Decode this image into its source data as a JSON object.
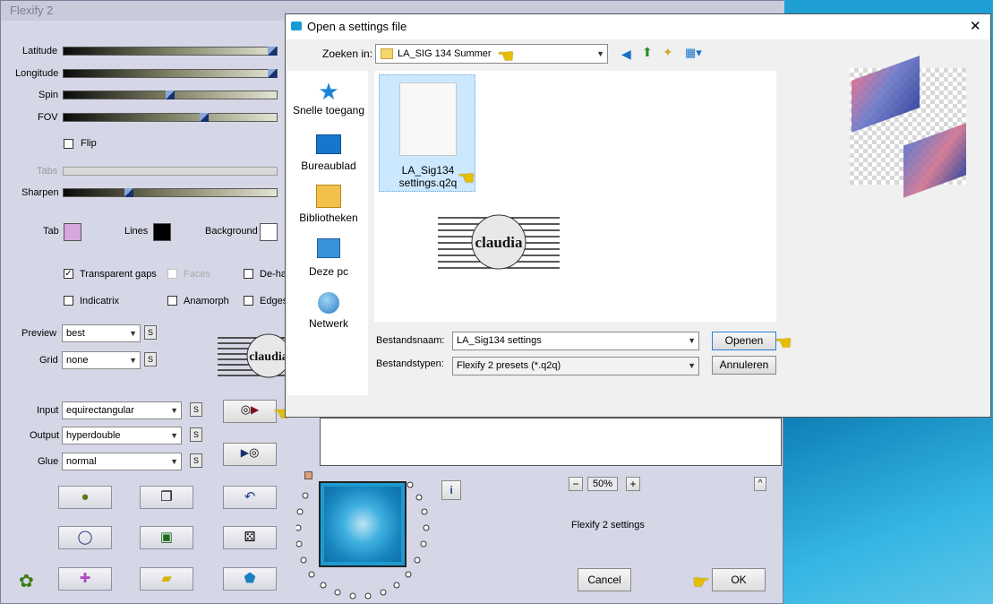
{
  "flexify": {
    "title": "Flexify 2",
    "latitude_label": "Latitude",
    "longitude_label": "Longitude",
    "spin_label": "Spin",
    "fov_label": "FOV",
    "flip_label": "Flip",
    "tabs_label": "Tabs",
    "sharpen_label": "Sharpen",
    "tab_label": "Tab",
    "lines_label": "Lines",
    "background_label": "Background",
    "transparent_gaps_label": "Transparent gaps",
    "faces_label": "Faces",
    "dehalo_label": "De-ha",
    "indicatrix_label": "Indicatrix",
    "anamorph_label": "Anamorph",
    "edges_label": "Edges",
    "preview_label": "Preview",
    "preview_value": "best",
    "grid_label": "Grid",
    "grid_value": "none",
    "input_label": "Input",
    "input_value": "equirectangular",
    "output_label": "Output",
    "output_value": "hyperdouble",
    "glue_label": "Glue",
    "glue_value": "normal",
    "s_label": "S",
    "zoom_minus": "−",
    "zoom_value": "50%",
    "zoom_plus": "+",
    "settings_label": "Flexify 2 settings",
    "cancel_label": "Cancel",
    "ok_label": "OK",
    "info_label": "i",
    "caret_label": "^",
    "tab_color": "#d6a6de",
    "lines_color": "#000000",
    "background_color": "#ffffff"
  },
  "dialog": {
    "title": "Open a settings file",
    "close_label": "✕",
    "look_in_label": "Zoeken in:",
    "look_in_value": "LA_SIG 134 Summer",
    "nav": [
      "Snelle toegang",
      "Bureaublad",
      "Bibliotheken",
      "Deze pc",
      "Netwerk"
    ],
    "file_name_line1": "LA_Sig134",
    "file_name_line2": "settings.q2q",
    "filename_label": "Bestandsnaam:",
    "filename_value": "LA_Sig134 settings",
    "filetype_label": "Bestandstypen:",
    "filetype_value": "Flexify 2 presets (*.q2q)",
    "open_label": "Openen",
    "cancel_label": "Annuleren"
  },
  "watermark_text": "claudia"
}
